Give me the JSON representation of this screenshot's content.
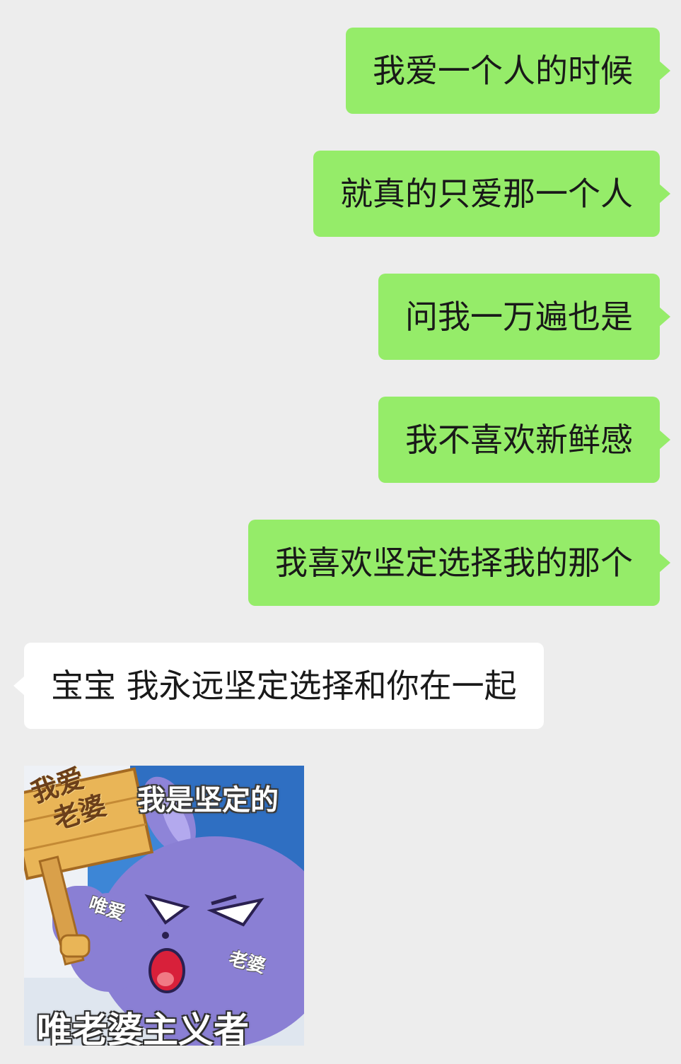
{
  "messages": [
    {
      "side": "me",
      "text": "我爱一个人的时候"
    },
    {
      "side": "me",
      "text": "就真的只爱那一个人"
    },
    {
      "side": "me",
      "text": "问我一万遍也是"
    },
    {
      "side": "me",
      "text": "我不喜欢新鲜感"
    },
    {
      "side": "me",
      "text": "我喜欢坚定选择我的那个"
    },
    {
      "side": "other",
      "text": "宝宝 我永远坚定选择和你在一起"
    }
  ],
  "sticker": {
    "sign_line1": "我爱",
    "sign_line2": "老婆",
    "caption_top": "我是坚定的",
    "caption_bottom": "唯老婆主义者",
    "label_left": "唯爱",
    "label_right": "老婆"
  },
  "colors": {
    "background": "#ededed",
    "me_bubble": "#95ec69",
    "other_bubble": "#ffffff"
  }
}
